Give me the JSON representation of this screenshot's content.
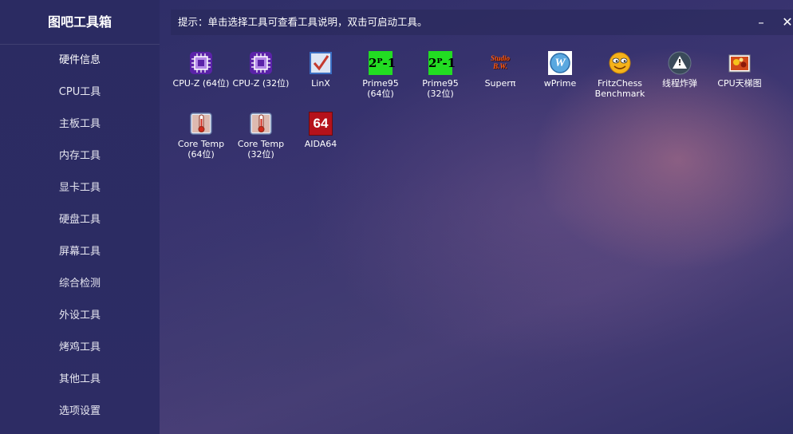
{
  "app": {
    "title": "图吧工具箱"
  },
  "sidebar": {
    "items": [
      {
        "label": "硬件信息"
      },
      {
        "label": "CPU工具"
      },
      {
        "label": "主板工具"
      },
      {
        "label": "内存工具"
      },
      {
        "label": "显卡工具"
      },
      {
        "label": "硬盘工具"
      },
      {
        "label": "屏幕工具"
      },
      {
        "label": "综合检测"
      },
      {
        "label": "外设工具"
      },
      {
        "label": "烤鸡工具"
      },
      {
        "label": "其他工具"
      },
      {
        "label": "选项设置"
      }
    ]
  },
  "header": {
    "hint": "提示：单击选择工具可查看工具说明，双击可启动工具。",
    "minimize": "–",
    "close": "✕"
  },
  "tools": [
    {
      "label": "CPU-Z (64位)",
      "icon": "cpuz-icon"
    },
    {
      "label": "CPU-Z (32位)",
      "icon": "cpuz-icon"
    },
    {
      "label": "LinX",
      "icon": "linx-checkbox-icon"
    },
    {
      "label": "Prime95\n(64位)",
      "icon": "prime95-icon",
      "icon_text": "2ᴾ-1"
    },
    {
      "label": "Prime95\n(32位)",
      "icon": "prime95-icon",
      "icon_text": "2ᴾ-1"
    },
    {
      "label": "Superπ",
      "icon": "superpi-icon",
      "icon_text": "Studio\nB.W."
    },
    {
      "label": "wPrime",
      "icon": "wprime-icon",
      "icon_text": "W"
    },
    {
      "label": "FritzChess\nBenchmark",
      "icon": "fritz-smiley-icon"
    },
    {
      "label": "线程炸弹",
      "icon": "warning-icon",
      "icon_text": "!"
    },
    {
      "label": "CPU天梯图",
      "icon": "cpu-ladder-image-icon"
    },
    {
      "label": "Core Temp\n(64位)",
      "icon": "thermometer-icon"
    },
    {
      "label": "Core Temp\n(32位)",
      "icon": "thermometer-icon"
    },
    {
      "label": "AIDA64",
      "icon": "aida64-icon",
      "icon_text": "64"
    }
  ],
  "colors": {
    "sidebar": "#2b2b62",
    "cpuz": "#6a2bb5",
    "prime_green": "#22dd22",
    "aida_red": "#b5121b"
  }
}
